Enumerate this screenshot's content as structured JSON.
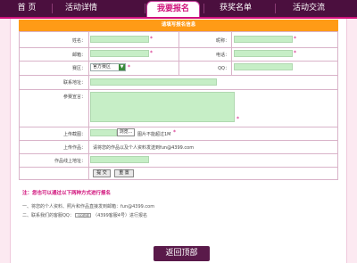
{
  "nav": {
    "items": [
      "首 页",
      "活动详情",
      "我要报名",
      "获奖名单",
      "活动交流"
    ],
    "active": "我要报名"
  },
  "form": {
    "title": "请填写报名信息",
    "fields": {
      "name_label": "姓名：",
      "nickname_label": "昵称：",
      "email_label": "邮箱：",
      "phone_label": "电话：",
      "region_label": "赛区：",
      "region_value": "官方赛区",
      "qq_label": "QQ：",
      "address_label": "联系地址：",
      "message_label": "参赛宣言：",
      "upload_label": "上传截图：",
      "upload_button": "浏览...",
      "upload_note": "图片不能超过1M",
      "works_label": "上传作品：",
      "works_note": "请将您的作品以及个人资料发送到fun@4399.com",
      "online_label": "作品线上地址：",
      "submit_button": "提 交",
      "reset_button": "重 置"
    },
    "required_mark": "*"
  },
  "methods": {
    "title": "注：您也可以通过以下两种方式进行报名",
    "line1": "一、将您的个人资料、照片和作品直接发到邮箱：fun@4399.com",
    "line2_prefix": "二、联系我们的客服QQ：",
    "line2_badge": "QQ在线",
    "line2_suffix": "（4399客服4号）进行报名"
  },
  "footer": {
    "back_top": "返回顶部"
  },
  "colors": {
    "nav_bg": "#4b0f3e",
    "accent": "#d0107a",
    "title_bar": "#ff9b16",
    "input_bg": "#c6eec6",
    "page_bg": "#fce9f1"
  }
}
